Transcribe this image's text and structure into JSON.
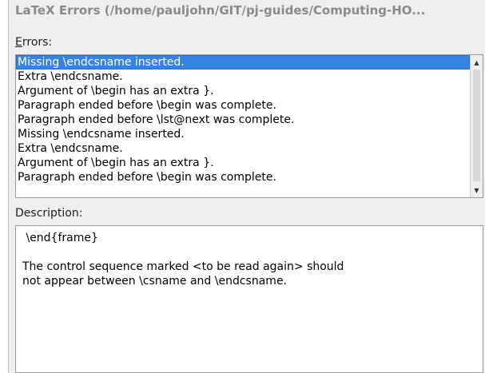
{
  "window": {
    "title": "LaTeX Errors (/home/pauljohn/GIT/pj-guides/Computing-HO..."
  },
  "errors_section": {
    "label_mnemonic": "E",
    "label_rest": "rrors:",
    "items": [
      {
        "label": "Missing \\endcsname inserted.",
        "selected": true
      },
      {
        "label": "Extra \\endcsname.",
        "selected": false
      },
      {
        "label": "Argument of \\begin has an extra }.",
        "selected": false
      },
      {
        "label": "Paragraph ended before \\begin was complete.",
        "selected": false
      },
      {
        "label": "Paragraph ended before \\lst@next was complete.",
        "selected": false
      },
      {
        "label": "Missing \\endcsname inserted.",
        "selected": false
      },
      {
        "label": "Extra \\endcsname.",
        "selected": false
      },
      {
        "label": "Argument of \\begin has an extra }.",
        "selected": false
      },
      {
        "label": "Paragraph ended before \\begin was complete.",
        "selected": false
      }
    ],
    "scroll_up_icon": "triangle-up",
    "scroll_down_icon": "triangle-down"
  },
  "description_section": {
    "label": "Description:",
    "line1": " \\end{frame}",
    "line3": "The control sequence marked <to be read again> should",
    "line4": "not appear between \\csname and \\endcsname."
  }
}
